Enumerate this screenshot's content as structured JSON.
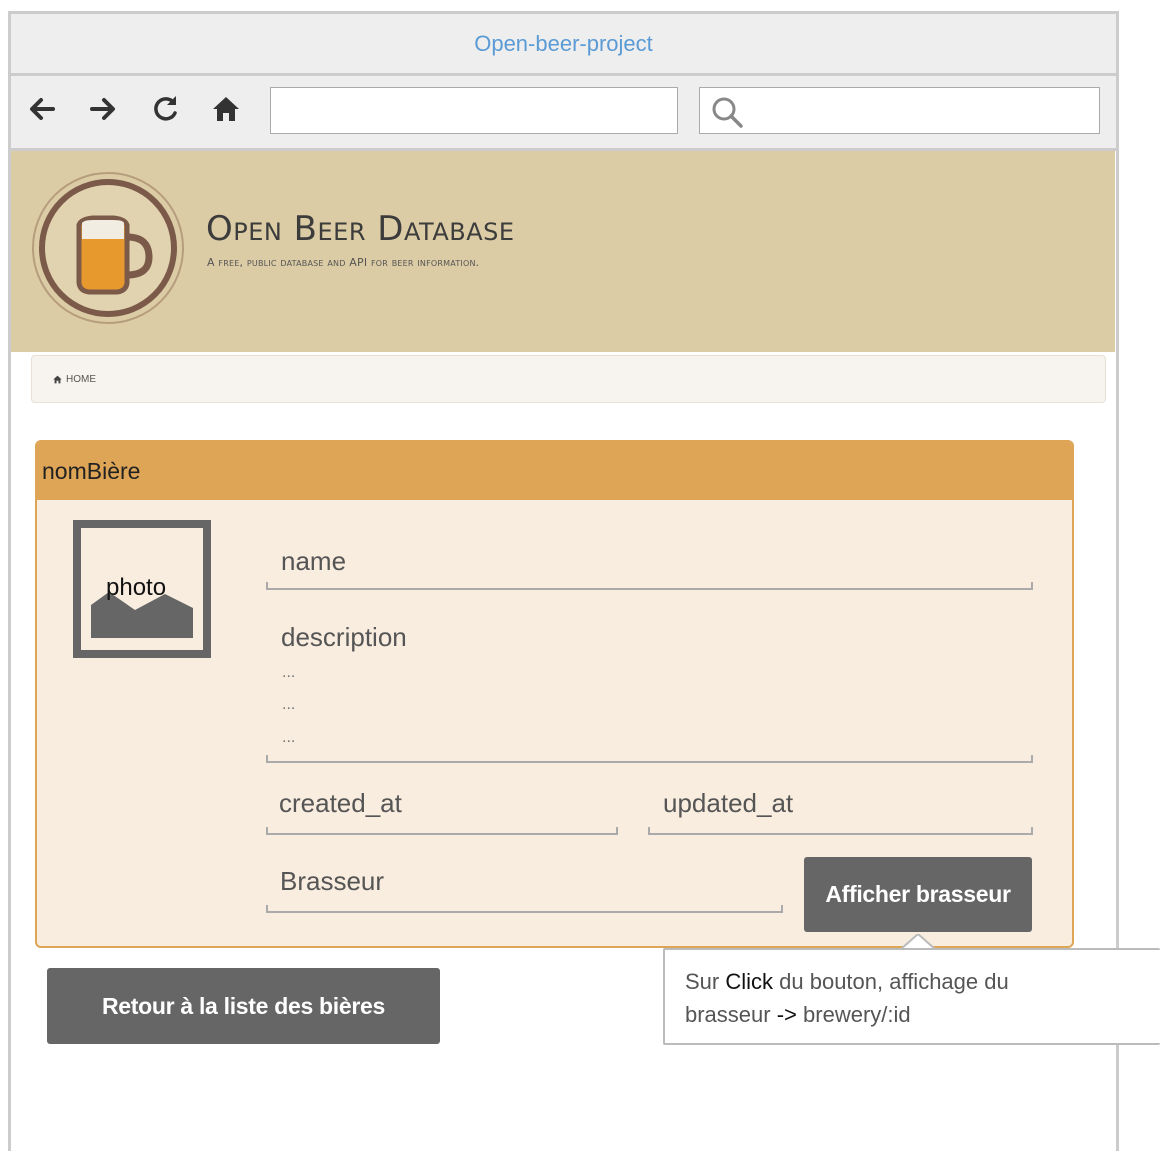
{
  "window": {
    "title": "Open-beer-project"
  },
  "toolbar": {
    "back_icon": "arrow-left-icon",
    "forward_icon": "arrow-right-icon",
    "reload_icon": "reload-icon",
    "home_icon": "home-icon",
    "url_value": "",
    "search_value": ""
  },
  "header": {
    "title": "Open Beer Database",
    "subtitle": "A free, public database and API for beer information."
  },
  "breadcrumb": {
    "home_label": "HOME"
  },
  "panel": {
    "heading": "nomBière",
    "photo_label": "photo",
    "name_label": "name",
    "description_label": "description",
    "description_lines": [
      "...",
      "...",
      "..."
    ],
    "created_label": "created_at",
    "updated_label": "updated_at",
    "brewer_label": "Brasseur",
    "show_brewer_button": "Afficher brasseur"
  },
  "back_button": "Retour à la liste des bières",
  "tooltip": {
    "prefix": "Sur ",
    "click_word": "Click",
    "line1_rest": " du bouton, affichage du",
    "line2_start": "brasseur ",
    "arrow": "->",
    "line2_end": " brewery/:id"
  },
  "colors": {
    "header_bg": "#dccca5",
    "panel_accent": "#dea556",
    "panel_bg": "#f9ede0",
    "button_bg": "#666666",
    "title_link": "#5b9bd5"
  }
}
